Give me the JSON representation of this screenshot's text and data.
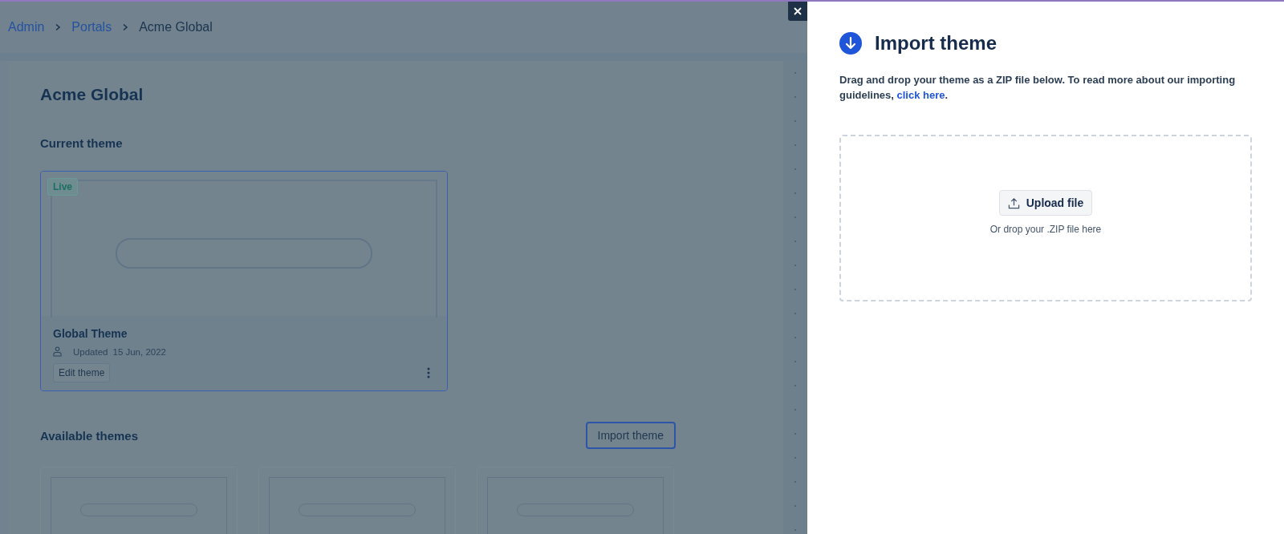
{
  "breadcrumb": [
    {
      "label": "Admin",
      "kind": "link"
    },
    {
      "label": "Portals",
      "kind": "link"
    },
    {
      "label": "Acme Global",
      "kind": "current"
    }
  ],
  "page_title": "Acme Global",
  "current_theme": {
    "heading": "Current theme",
    "badge": "Live",
    "name": "Global Theme",
    "updated_label": "Updated",
    "updated_date": "15 Jun, 2022",
    "edit_button": "Edit theme"
  },
  "available_themes": {
    "heading": "Available themes",
    "import_button": "Import theme"
  },
  "panel": {
    "title": "Import theme",
    "description": "Drag and drop your theme as a ZIP file below. To read more about our importing guidelines, ",
    "link": "click here",
    "after_link": ".",
    "upload_button": "Upload file",
    "drop_hint": "Or drop your .ZIP file here"
  }
}
